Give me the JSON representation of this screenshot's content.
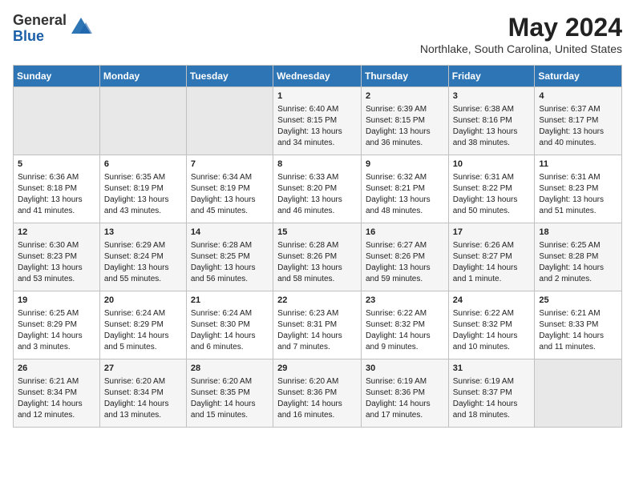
{
  "logo": {
    "general": "General",
    "blue": "Blue"
  },
  "header": {
    "month_year": "May 2024",
    "location": "Northlake, South Carolina, United States"
  },
  "days_of_week": [
    "Sunday",
    "Monday",
    "Tuesday",
    "Wednesday",
    "Thursday",
    "Friday",
    "Saturday"
  ],
  "weeks": [
    [
      {
        "day": "",
        "info": ""
      },
      {
        "day": "",
        "info": ""
      },
      {
        "day": "",
        "info": ""
      },
      {
        "day": "1",
        "info": "Sunrise: 6:40 AM\nSunset: 8:15 PM\nDaylight: 13 hours and 34 minutes."
      },
      {
        "day": "2",
        "info": "Sunrise: 6:39 AM\nSunset: 8:15 PM\nDaylight: 13 hours and 36 minutes."
      },
      {
        "day": "3",
        "info": "Sunrise: 6:38 AM\nSunset: 8:16 PM\nDaylight: 13 hours and 38 minutes."
      },
      {
        "day": "4",
        "info": "Sunrise: 6:37 AM\nSunset: 8:17 PM\nDaylight: 13 hours and 40 minutes."
      }
    ],
    [
      {
        "day": "5",
        "info": "Sunrise: 6:36 AM\nSunset: 8:18 PM\nDaylight: 13 hours and 41 minutes."
      },
      {
        "day": "6",
        "info": "Sunrise: 6:35 AM\nSunset: 8:19 PM\nDaylight: 13 hours and 43 minutes."
      },
      {
        "day": "7",
        "info": "Sunrise: 6:34 AM\nSunset: 8:19 PM\nDaylight: 13 hours and 45 minutes."
      },
      {
        "day": "8",
        "info": "Sunrise: 6:33 AM\nSunset: 8:20 PM\nDaylight: 13 hours and 46 minutes."
      },
      {
        "day": "9",
        "info": "Sunrise: 6:32 AM\nSunset: 8:21 PM\nDaylight: 13 hours and 48 minutes."
      },
      {
        "day": "10",
        "info": "Sunrise: 6:31 AM\nSunset: 8:22 PM\nDaylight: 13 hours and 50 minutes."
      },
      {
        "day": "11",
        "info": "Sunrise: 6:31 AM\nSunset: 8:23 PM\nDaylight: 13 hours and 51 minutes."
      }
    ],
    [
      {
        "day": "12",
        "info": "Sunrise: 6:30 AM\nSunset: 8:23 PM\nDaylight: 13 hours and 53 minutes."
      },
      {
        "day": "13",
        "info": "Sunrise: 6:29 AM\nSunset: 8:24 PM\nDaylight: 13 hours and 55 minutes."
      },
      {
        "day": "14",
        "info": "Sunrise: 6:28 AM\nSunset: 8:25 PM\nDaylight: 13 hours and 56 minutes."
      },
      {
        "day": "15",
        "info": "Sunrise: 6:28 AM\nSunset: 8:26 PM\nDaylight: 13 hours and 58 minutes."
      },
      {
        "day": "16",
        "info": "Sunrise: 6:27 AM\nSunset: 8:26 PM\nDaylight: 13 hours and 59 minutes."
      },
      {
        "day": "17",
        "info": "Sunrise: 6:26 AM\nSunset: 8:27 PM\nDaylight: 14 hours and 1 minute."
      },
      {
        "day": "18",
        "info": "Sunrise: 6:25 AM\nSunset: 8:28 PM\nDaylight: 14 hours and 2 minutes."
      }
    ],
    [
      {
        "day": "19",
        "info": "Sunrise: 6:25 AM\nSunset: 8:29 PM\nDaylight: 14 hours and 3 minutes."
      },
      {
        "day": "20",
        "info": "Sunrise: 6:24 AM\nSunset: 8:29 PM\nDaylight: 14 hours and 5 minutes."
      },
      {
        "day": "21",
        "info": "Sunrise: 6:24 AM\nSunset: 8:30 PM\nDaylight: 14 hours and 6 minutes."
      },
      {
        "day": "22",
        "info": "Sunrise: 6:23 AM\nSunset: 8:31 PM\nDaylight: 14 hours and 7 minutes."
      },
      {
        "day": "23",
        "info": "Sunrise: 6:22 AM\nSunset: 8:32 PM\nDaylight: 14 hours and 9 minutes."
      },
      {
        "day": "24",
        "info": "Sunrise: 6:22 AM\nSunset: 8:32 PM\nDaylight: 14 hours and 10 minutes."
      },
      {
        "day": "25",
        "info": "Sunrise: 6:21 AM\nSunset: 8:33 PM\nDaylight: 14 hours and 11 minutes."
      }
    ],
    [
      {
        "day": "26",
        "info": "Sunrise: 6:21 AM\nSunset: 8:34 PM\nDaylight: 14 hours and 12 minutes."
      },
      {
        "day": "27",
        "info": "Sunrise: 6:20 AM\nSunset: 8:34 PM\nDaylight: 14 hours and 13 minutes."
      },
      {
        "day": "28",
        "info": "Sunrise: 6:20 AM\nSunset: 8:35 PM\nDaylight: 14 hours and 15 minutes."
      },
      {
        "day": "29",
        "info": "Sunrise: 6:20 AM\nSunset: 8:36 PM\nDaylight: 14 hours and 16 minutes."
      },
      {
        "day": "30",
        "info": "Sunrise: 6:19 AM\nSunset: 8:36 PM\nDaylight: 14 hours and 17 minutes."
      },
      {
        "day": "31",
        "info": "Sunrise: 6:19 AM\nSunset: 8:37 PM\nDaylight: 14 hours and 18 minutes."
      },
      {
        "day": "",
        "info": ""
      }
    ]
  ]
}
